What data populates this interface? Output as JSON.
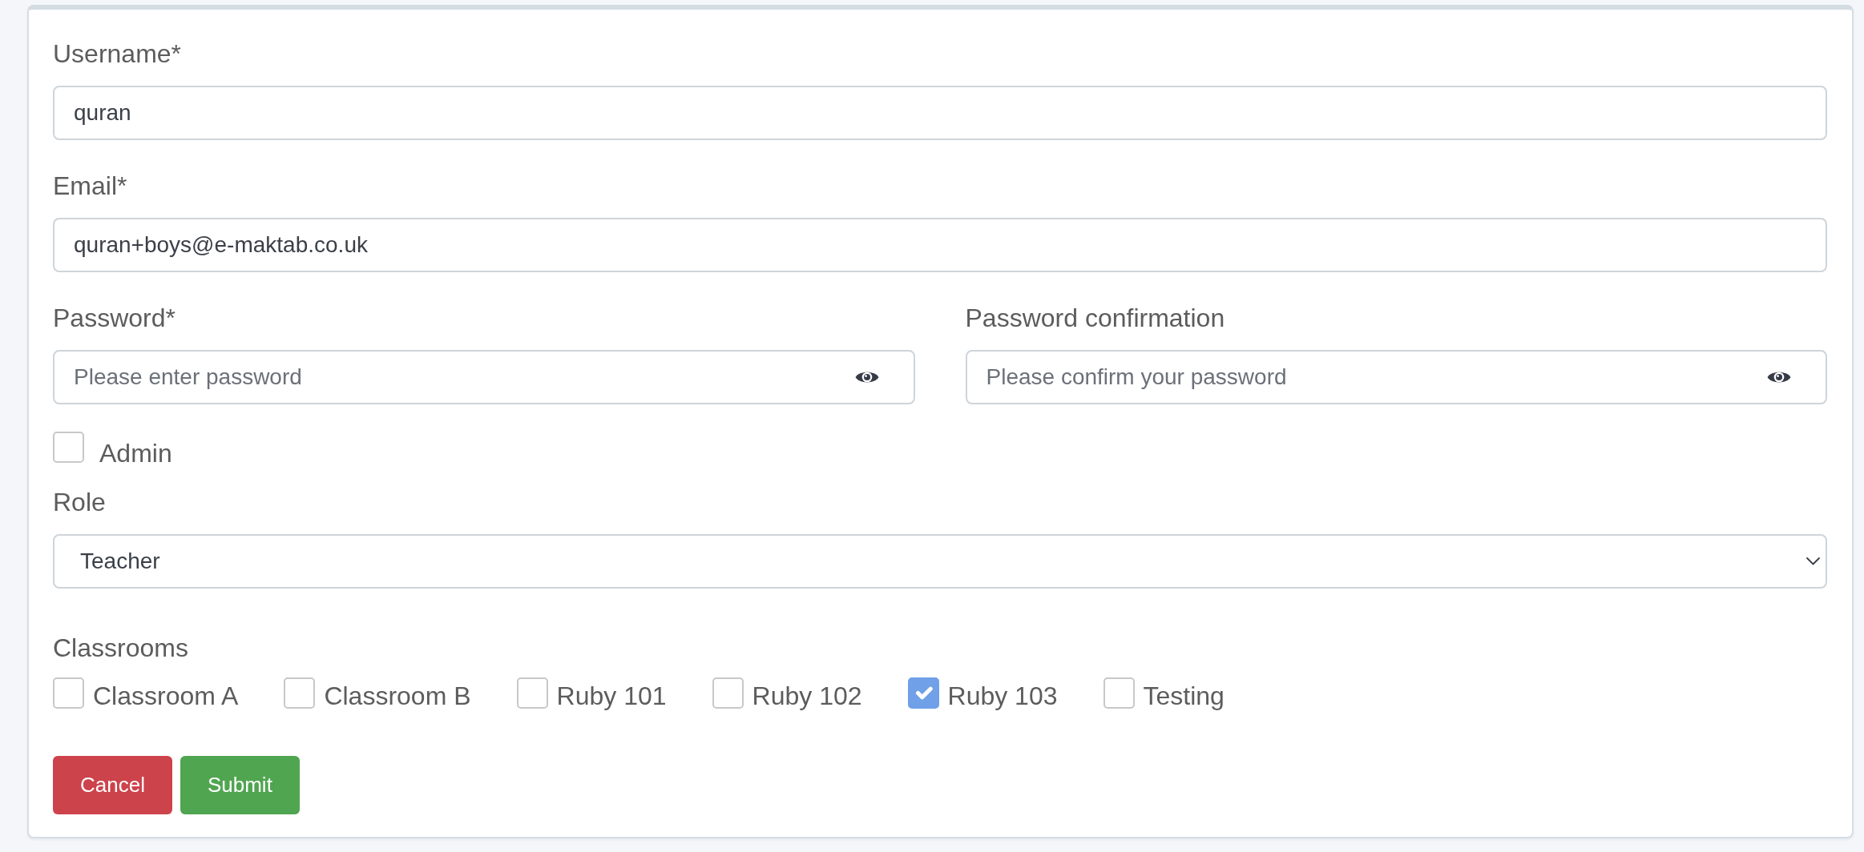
{
  "form": {
    "fields": [
      {
        "label": "Username*",
        "value": "quran"
      },
      {
        "label": "Email*",
        "value": "quran+boys@e-maktab.co.uk"
      }
    ],
    "password_fields": [
      {
        "label": "Password*",
        "placeholder": "Please enter password"
      },
      {
        "label": "Password confirmation",
        "placeholder": "Please confirm your password"
      }
    ],
    "admin": {
      "label": "Admin",
      "checked": false
    },
    "role": {
      "label": "Role",
      "value": "Teacher"
    },
    "classrooms": {
      "label": "Classrooms",
      "options": [
        {
          "label": "Classroom A",
          "checked": false
        },
        {
          "label": "Classroom B",
          "checked": false
        },
        {
          "label": "Ruby 101",
          "checked": false
        },
        {
          "label": "Ruby 102",
          "checked": false
        },
        {
          "label": "Ruby 103",
          "checked": true
        },
        {
          "label": "Testing",
          "checked": false
        }
      ]
    },
    "buttons": [
      {
        "label": "Cancel",
        "kind": "cancel"
      },
      {
        "label": "Submit",
        "kind": "submit"
      }
    ]
  }
}
